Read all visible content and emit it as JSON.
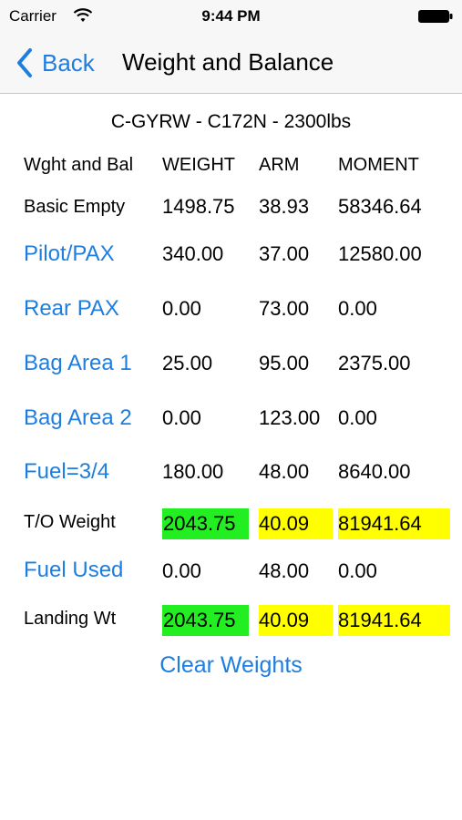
{
  "status_bar": {
    "carrier": "Carrier",
    "time": "9:44 PM"
  },
  "nav": {
    "back_label": "Back",
    "title": "Weight and Balance"
  },
  "aircraft": "C-GYRW - C172N - 2300lbs",
  "headers": {
    "label": "Wght and Bal",
    "weight": "WEIGHT",
    "arm": "ARM",
    "moment": "MOMENT"
  },
  "rows": [
    {
      "label": "Basic Empty",
      "weight": "1498.75",
      "arm": "38.93",
      "moment": "58346.64"
    },
    {
      "label": "Pilot/PAX",
      "weight": "340.00",
      "arm": "37.00",
      "moment": "12580.00"
    },
    {
      "label": "Rear PAX",
      "weight": "0.00",
      "arm": "73.00",
      "moment": "0.00"
    },
    {
      "label": "Bag Area 1",
      "weight": "25.00",
      "arm": "95.00",
      "moment": "2375.00"
    },
    {
      "label": "Bag Area 2",
      "weight": "0.00",
      "arm": "123.00",
      "moment": "0.00"
    },
    {
      "label": "Fuel=3/4",
      "weight": "180.00",
      "arm": "48.00",
      "moment": "8640.00"
    },
    {
      "label": "T/O Weight",
      "weight": "2043.75",
      "arm": "40.09",
      "moment": "81941.64"
    },
    {
      "label": "Fuel Used",
      "weight": "0.00",
      "arm": "48.00",
      "moment": "0.00"
    },
    {
      "label": "Landing Wt",
      "weight": "2043.75",
      "arm": "40.09",
      "moment": "81941.64"
    }
  ],
  "clear_button": "Clear Weights",
  "colors": {
    "accent": "#1e7ee0",
    "weight_ok": "#22ee22",
    "cg_highlight": "#ffff00"
  },
  "icons": {
    "wifi": "wifi-icon",
    "battery": "battery-icon",
    "back": "chevron-left-icon"
  }
}
